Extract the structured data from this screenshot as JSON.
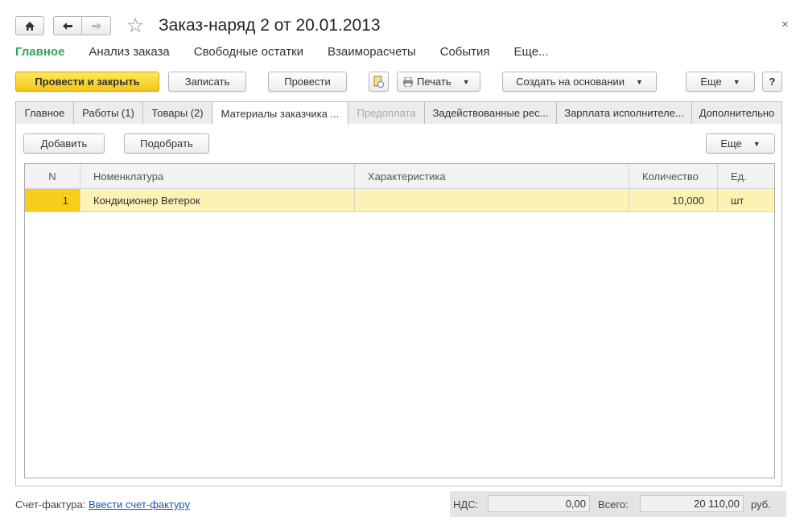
{
  "window": {
    "title": "Заказ-наряд 2 от 20.01.2013",
    "close_symbol": "×"
  },
  "menu": {
    "items": [
      "Главное",
      "Анализ заказа",
      "Свободные остатки",
      "Взаиморасчеты",
      "События",
      "Еще..."
    ],
    "active_index": 0
  },
  "toolbar": {
    "post_and_close": "Провести и закрыть",
    "save": "Записать",
    "post": "Провести",
    "print": "Печать",
    "create_based_on": "Создать на основании",
    "more": "Еще",
    "help": "?"
  },
  "tabs": [
    {
      "label": "Главное",
      "state": "normal"
    },
    {
      "label": "Работы (1)",
      "state": "normal"
    },
    {
      "label": "Товары (2)",
      "state": "normal"
    },
    {
      "label": "Материалы заказчика ...",
      "state": "active"
    },
    {
      "label": "Предоплата",
      "state": "disabled"
    },
    {
      "label": "Задействованные рес...",
      "state": "normal"
    },
    {
      "label": "Зарплата исполнителе...",
      "state": "normal"
    },
    {
      "label": "Дополнительно",
      "state": "normal"
    }
  ],
  "table_toolbar": {
    "add": "Добавить",
    "pick": "Подобрать",
    "more": "Еще"
  },
  "table": {
    "columns": [
      "N",
      "Номенклатура",
      "Характеристика",
      "Количество",
      "Ед."
    ],
    "rows": [
      {
        "n": "1",
        "nomenclature": "Кондиционер Ветерок",
        "characteristic": "",
        "quantity": "10,000",
        "unit": "шт"
      }
    ]
  },
  "footer": {
    "invoice_label": "Счет-фактура:",
    "invoice_link": "Ввести счет-фактуру",
    "vat_label": "НДС:",
    "vat_value": "0,00",
    "total_label": "Всего:",
    "total_value": "20 110,00",
    "currency": "руб."
  },
  "colors": {
    "accent_green": "#35a35a",
    "primary_button": "#f5c518",
    "selected_row": "#fbf2b4",
    "link": "#1b55b8"
  }
}
